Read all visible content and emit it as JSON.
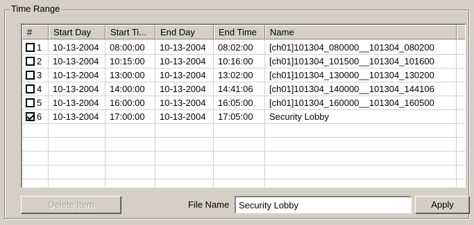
{
  "group": {
    "title": "Time Range"
  },
  "list": {
    "columns": [
      "#",
      "Start Day",
      "Start Ti...",
      "End Day",
      "End Time",
      "Name"
    ],
    "rows": [
      {
        "num": "1",
        "checked": false,
        "start_day": "10-13-2004",
        "start_time": "08:00:00",
        "end_day": "10-13-2004",
        "end_time": "08:02:00",
        "name": "[ch01]101304_080000__101304_080200"
      },
      {
        "num": "2",
        "checked": false,
        "start_day": "10-13-2004",
        "start_time": "10:15:00",
        "end_day": "10-13-2004",
        "end_time": "10:16:00",
        "name": "[ch01]101304_101500__101304_101600"
      },
      {
        "num": "3",
        "checked": false,
        "start_day": "10-13-2004",
        "start_time": "13:00:00",
        "end_day": "10-13-2004",
        "end_time": "13:02:00",
        "name": "[ch01]101304_130000__101304_130200"
      },
      {
        "num": "4",
        "checked": false,
        "start_day": "10-13-2004",
        "start_time": "14:00:00",
        "end_day": "10-13-2004",
        "end_time": "14:41:06",
        "name": "[ch01]101304_140000__101304_144106"
      },
      {
        "num": "5",
        "checked": false,
        "start_day": "10-13-2004",
        "start_time": "16:00:00",
        "end_day": "10-13-2004",
        "end_time": "16:05:00",
        "name": "[ch01]101304_160000__101304_160500"
      },
      {
        "num": "6",
        "checked": true,
        "start_day": "10-13-2004",
        "start_time": "17:00:00",
        "end_day": "10-13-2004",
        "end_time": "17:05:00",
        "name": "Security Lobby"
      }
    ]
  },
  "controls": {
    "delete_label": "Delete Item",
    "file_name_label": "File Name",
    "file_name_value": "Security Lobby",
    "apply_label": "Apply"
  }
}
